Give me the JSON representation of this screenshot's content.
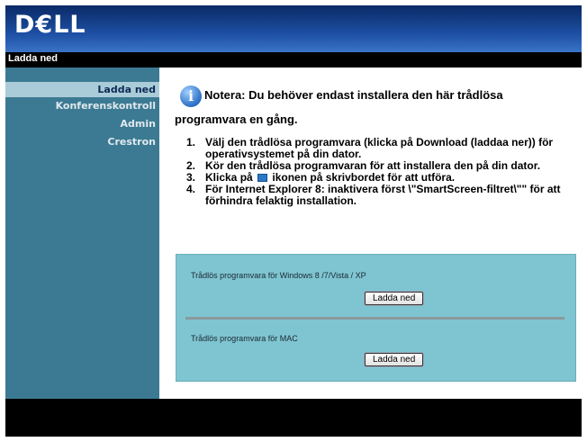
{
  "header": {
    "logo_text": "D€LL"
  },
  "page_title": "Ladda ned",
  "sidebar": {
    "items": [
      {
        "label": "Ladda ned",
        "active": true
      },
      {
        "label": "Konferenskontroll",
        "active": false
      },
      {
        "label": "Admin",
        "active": false
      },
      {
        "label": "Crestron",
        "active": false
      }
    ]
  },
  "main": {
    "note_line1": "Notera: Du behöver endast installera den här trådlösa",
    "note_line2": "programvara en gång.",
    "steps": [
      {
        "num": "1.",
        "text": "Välj den trådlösa programvara (klicka på Download (laddaa ner)) för operativsystemet på din dator."
      },
      {
        "num": "2.",
        "text": "Kör den trådlösa programvaran för att installera den på din dator."
      },
      {
        "num": "3.",
        "text_before": "Klicka på",
        "icon": "screen-icon",
        "text_after": "ikonen på skrivbordet för att utföra."
      },
      {
        "num": "4.",
        "text": "För Internet Explorer 8: inaktivera först \\\"SmartScreen-filtret\\\"\" för att förhindra felaktig installation."
      }
    ],
    "downloads": [
      {
        "label": "Trådlös programvara för Windows 8 /7/Vista / XP",
        "button": "Ladda ned"
      },
      {
        "label": "Trådlös programvara för MAC",
        "button": "Ladda ned"
      }
    ]
  },
  "colors": {
    "sidebar_bg": "#3c7a93",
    "sidebar_active_bg": "#a9ccd8",
    "download_box_bg": "#7fc4d1",
    "header_blue": "#1d4fa3"
  }
}
